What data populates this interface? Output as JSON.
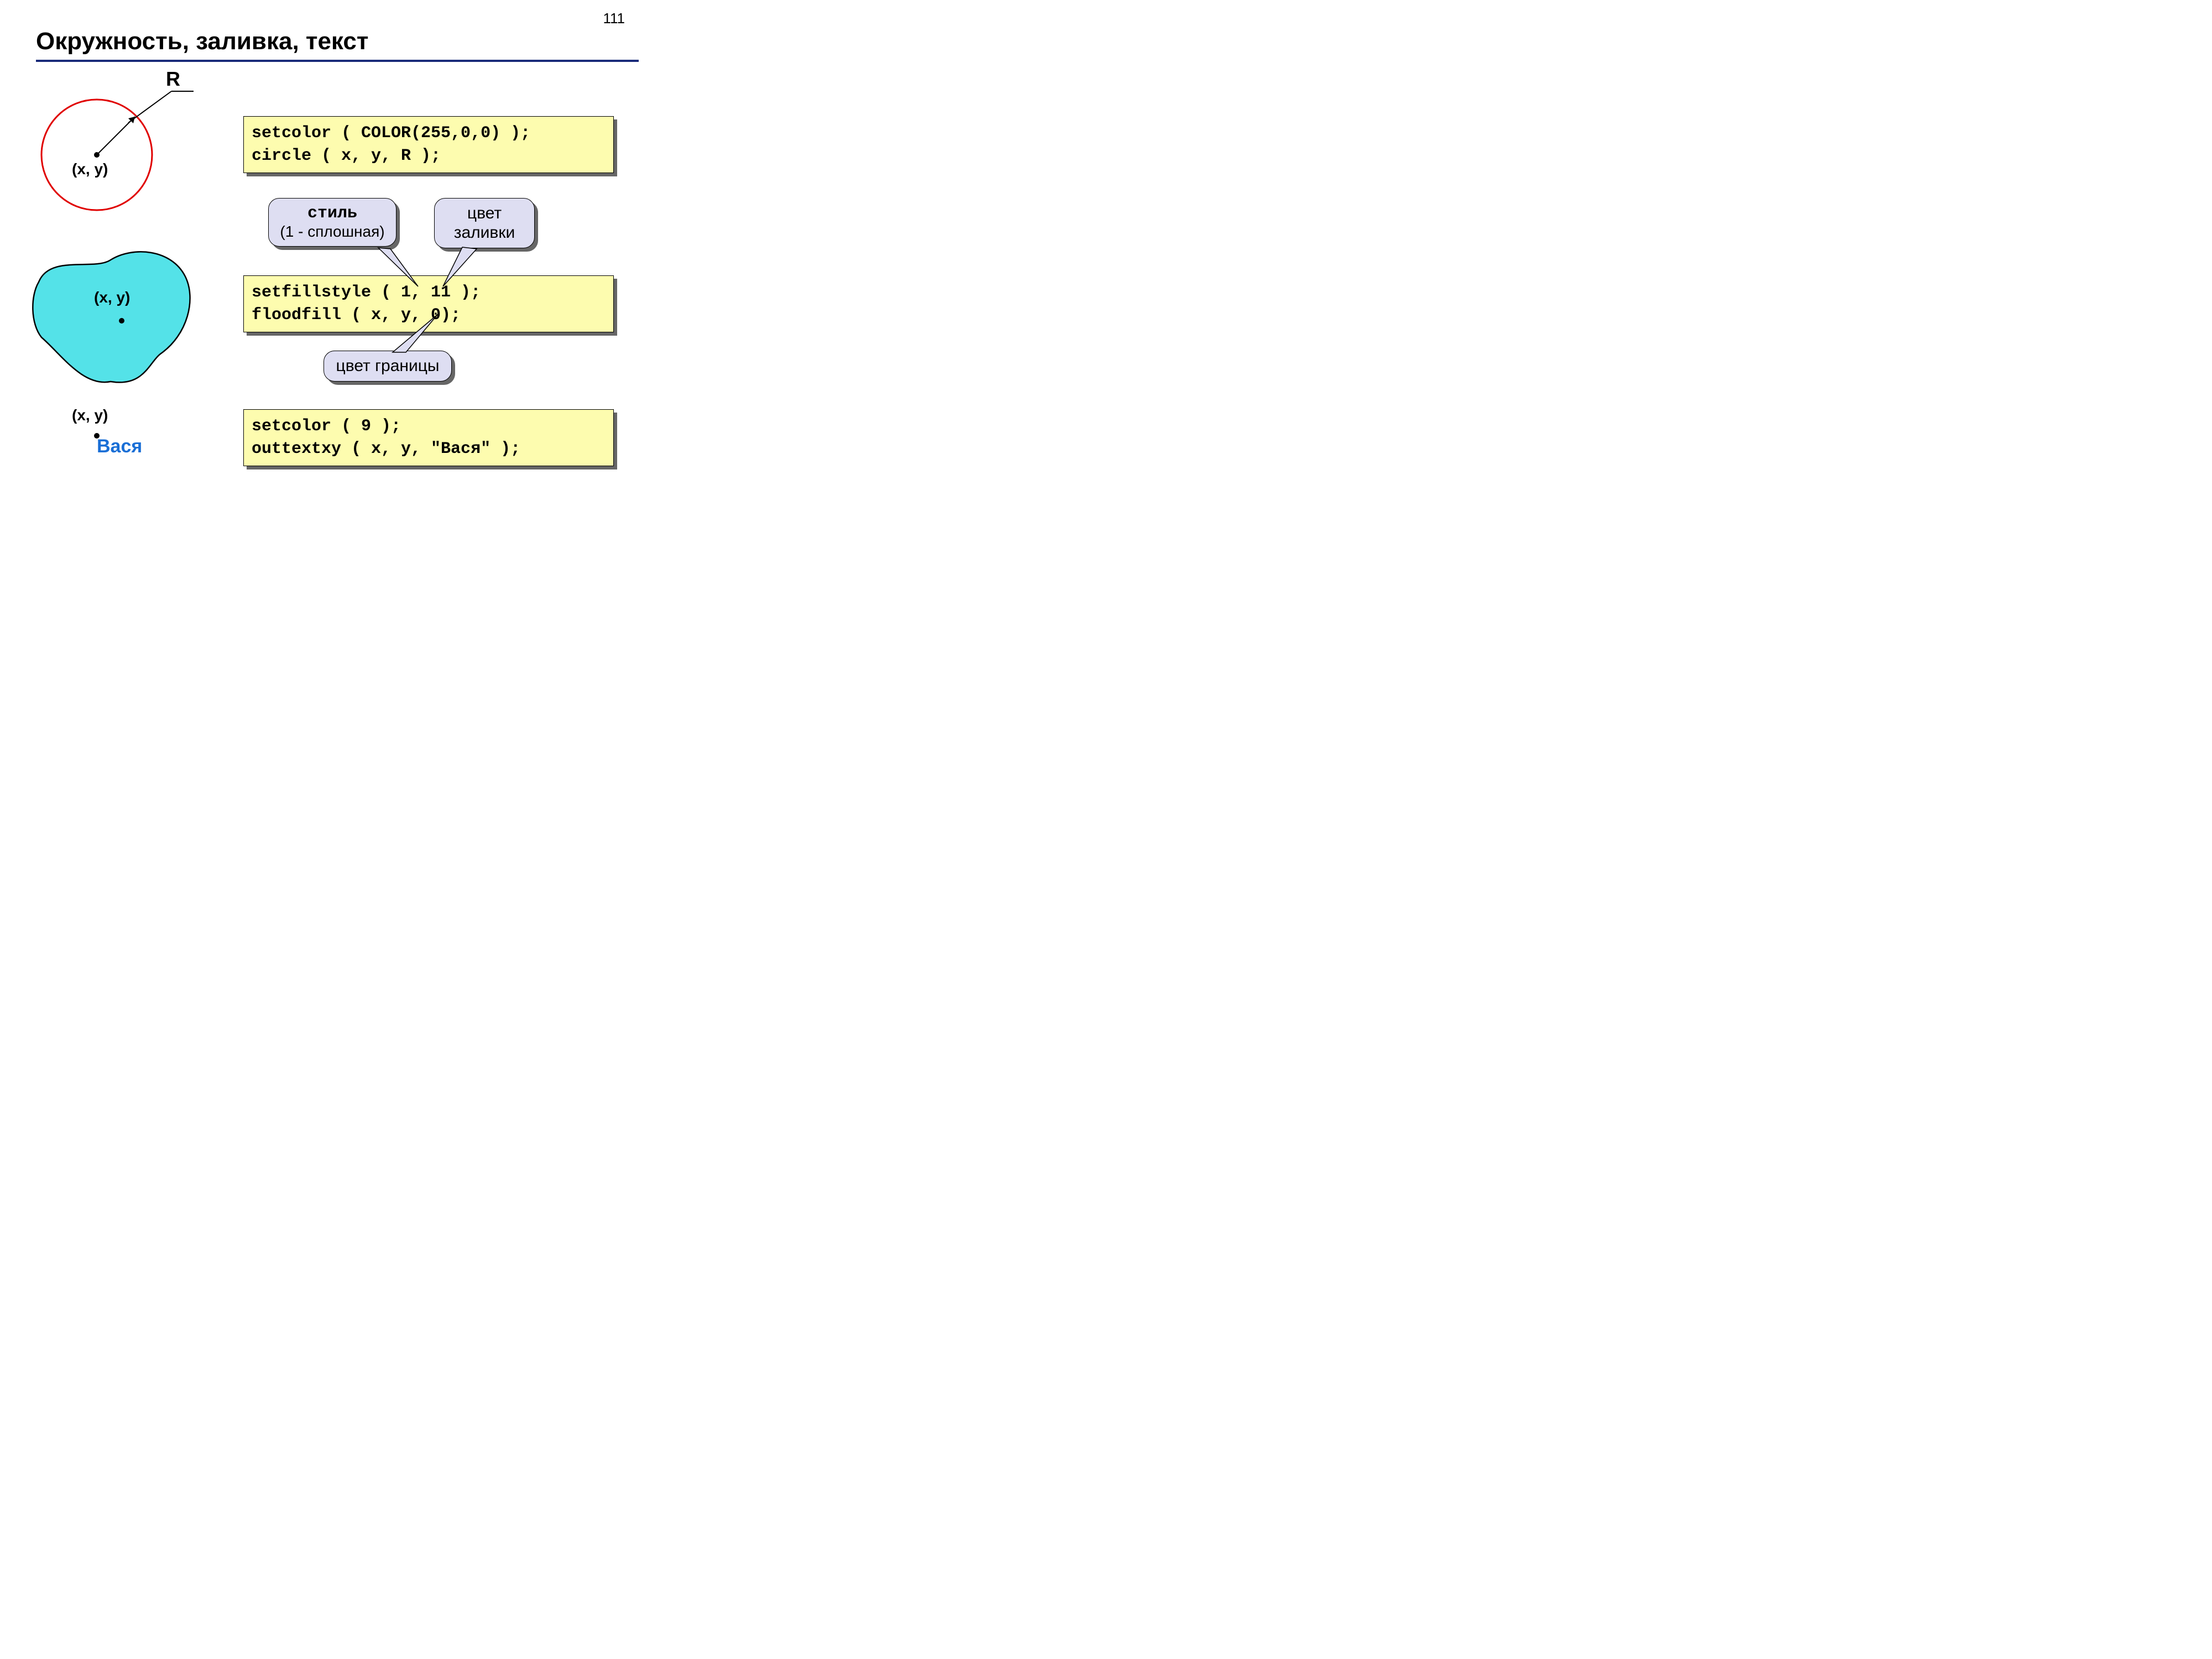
{
  "pageNumber": "111",
  "title": "Окружность, заливка, текст",
  "circle": {
    "radiusLabel": "R",
    "centerLabel": "(x, y)",
    "code": "setcolor ( COLOR(255,0,0) );\ncircle ( x, y, R );"
  },
  "fill": {
    "pointLabel": "(x, y)",
    "code": "setfillstyle ( 1, 11 );\nfloodfill ( x, y, 0);",
    "calloutStyleBold": "стиль",
    "calloutStylePlain": "(1 - сплошная)",
    "calloutFillColor": "цвет заливки",
    "calloutBorderColor": "цвет границы"
  },
  "text": {
    "pointLabel": "(x, y)",
    "outputText": "Вася",
    "code": "setcolor ( 9 );\nouttextxy ( x, y, \"Вася\" );"
  }
}
